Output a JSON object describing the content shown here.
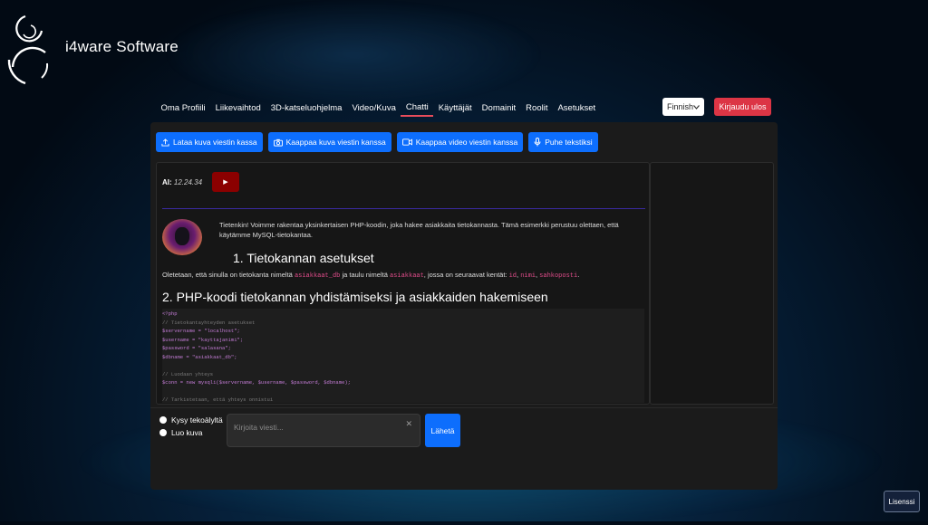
{
  "brand": {
    "name": "i4ware Software"
  },
  "nav": {
    "items": [
      "Oma Profiili",
      "Liikevaihtod",
      "3D-katseluohjelma",
      "Video/Kuva",
      "Chatti",
      "Käyttäjät",
      "Domainit",
      "Roolit",
      "Asetukset"
    ],
    "active": "Chatti"
  },
  "language": {
    "selected": "Finnish"
  },
  "logout_label": "Kirjaudu ulos",
  "actions": {
    "upload": "Lataa kuva viestin kassa",
    "capture_image": "Kaappaa kuva viestin kanssa",
    "capture_video": "Kaappaa video viestin kanssa",
    "speech": "Puhe tekstiksi"
  },
  "message": {
    "sender": "AI:",
    "time": "12.24.34",
    "play_symbol": "▶",
    "intro": "Tietenkin! Voimme rakentaa yksinkertaisen PHP-koodin, joka hakee asiakkaita tietokannasta. Tämä esimerkki perustuu olettaen, että käytämme MySQL-tietokantaa.",
    "heading1": "1. Tietokannan asetukset",
    "para_parts": [
      "Oletetaan, että sinulla on tietokanta nimeltä ",
      "asiakkaat_db",
      " ja taulu nimeltä ",
      "asiakkaat",
      ", jossa on seuraavat kentät: ",
      "id",
      ", ",
      "nimi",
      ", ",
      "sahkoposti",
      "."
    ],
    "heading2": "2. PHP-koodi tietokannan yhdistämiseksi ja asiakkaiden hakemiseen",
    "code_lines": [
      "<?php",
      "// Tietokantayhteyden asetukset",
      "$servername = \"localhost\";",
      "$username = \"kayttajanimi\";",
      "$password = \"salasana\";",
      "$dbname = \"asiakkaat_db\";",
      "",
      "// Luodaan yhteys",
      "$conn = new mysqli($servername, $username, $password, $dbname);",
      "",
      "// Tarkistetaan, että yhteys onnistui"
    ]
  },
  "composer": {
    "option_ask": "Kysy tekoälyltä",
    "option_image": "Luo kuva",
    "placeholder": "Kirjoita viesti...",
    "clear_symbol": "✕",
    "send": "Lähetä"
  },
  "license_label": "Lisenssi"
}
